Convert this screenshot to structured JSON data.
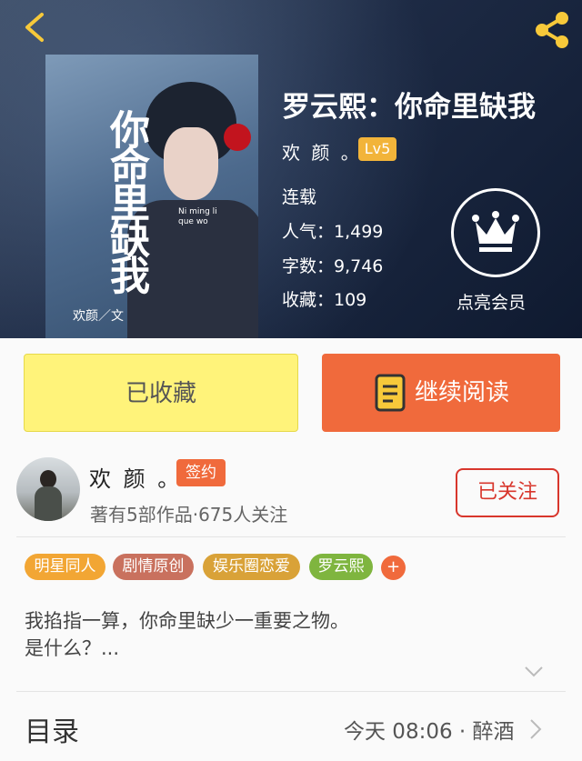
{
  "header": {
    "cover_title": "你命里缺我",
    "cover_name": "罗云熙",
    "cover_author": "欢颜／文",
    "cover_pinyin": "Ni ming li que wo",
    "title": "罗云熙：你命里缺我",
    "author": "欢 颜 。",
    "level": "Lv5",
    "status": "连载",
    "popularity": "人气：1,499",
    "word_count": "字数：9,746",
    "favorites": "收藏：109",
    "vip_label": "点亮会员"
  },
  "actions": {
    "favorite_label": "已收藏",
    "read_label": "继续阅读"
  },
  "author_row": {
    "name": "欢 颜 。",
    "sign_badge": "签约",
    "works_info": "著有5部作品·675人关注",
    "follow_label": "已关注"
  },
  "tags": [
    {
      "label": "明星同人",
      "color": "#f2a634"
    },
    {
      "label": "剧情原创",
      "color": "#c9715e"
    },
    {
      "label": "娱乐圈恋爱",
      "color": "#d9a238"
    },
    {
      "label": "罗云熙",
      "color": "#7fb53f"
    }
  ],
  "tag_add": "+",
  "description": {
    "line1": "我掐指一算，你命里缺少一重要之物。",
    "line2": "是什么？..."
  },
  "toc": {
    "label": "目录",
    "latest": "今天 08:06 · 醉酒"
  },
  "colors": {
    "accent_orange": "#f06a3c",
    "favorite_yellow": "#fff37a",
    "follow_red": "#d8362c",
    "icon_yellow": "#f7c93a"
  }
}
